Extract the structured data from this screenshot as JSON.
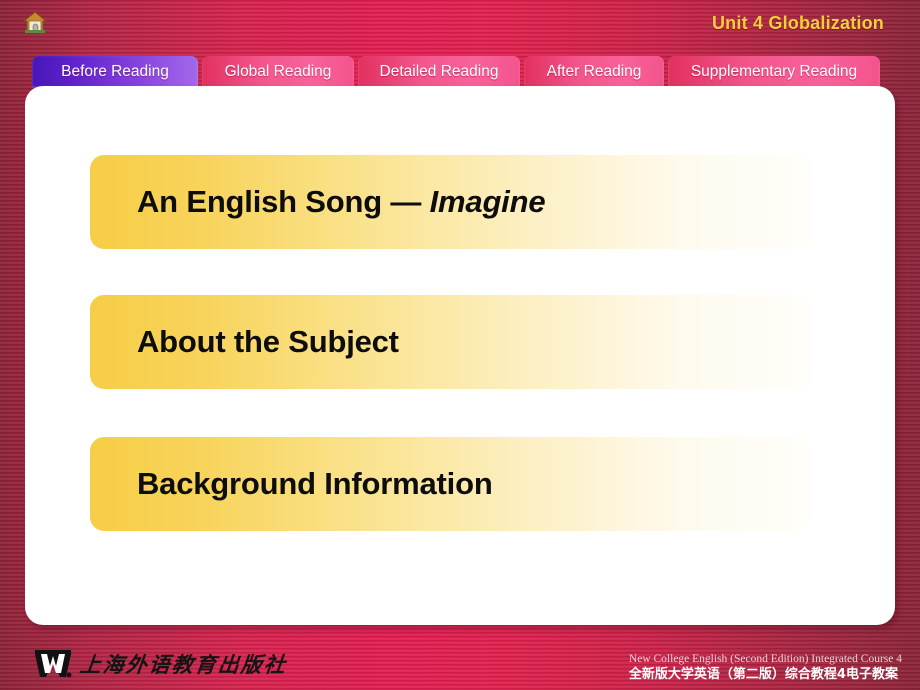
{
  "header": {
    "home_icon": "home-icon",
    "unit_title": "Unit 4 Globalization"
  },
  "tabs": [
    {
      "label": "Before Reading",
      "state": "active"
    },
    {
      "label": "Global Reading",
      "state": "inactive"
    },
    {
      "label": "Detailed Reading",
      "state": "inactive"
    },
    {
      "label": "After Reading",
      "state": "inactive"
    },
    {
      "label": "Supplementary Reading",
      "state": "inactive"
    }
  ],
  "content": {
    "items": [
      {
        "text_plain": "An English Song — ",
        "text_italic": "Imagine"
      },
      {
        "text_plain": "About the Subject",
        "text_italic": ""
      },
      {
        "text_plain": "Background Information",
        "text_italic": ""
      }
    ]
  },
  "footer": {
    "logo_icon": "w-logo-icon",
    "publisher_name": "上海外语教育出版社",
    "course_en": "New College English (Second Edition) Integrated Course 4",
    "course_cn": "全新版大学英语（第二版）综合教程4电子教案"
  },
  "colors": {
    "background_center": "#e51d52",
    "background_edge": "#8c2338",
    "title_gold": "#f5cf3a",
    "tab_active_start": "#4715b8",
    "tab_active_end": "#a269ea",
    "tab_inactive_start": "#e2305f",
    "tab_inactive_end": "#f8629a",
    "bar_gold": "#f6cd46",
    "bar_fade": "#fffefa",
    "panel_white": "#ffffff"
  }
}
